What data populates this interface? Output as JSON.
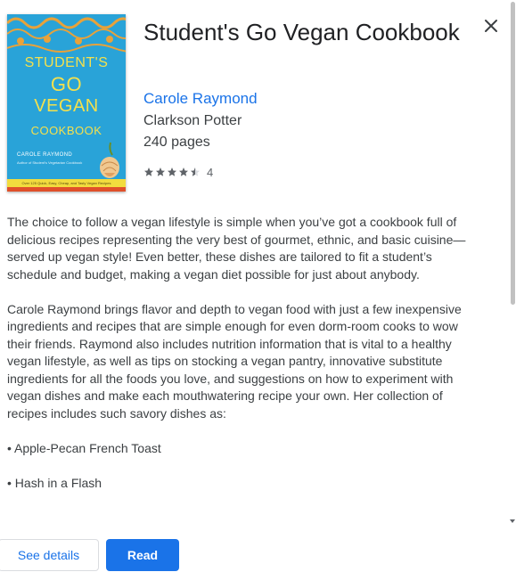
{
  "book": {
    "title": "Student's Go Vegan Cookbook",
    "author": "Carole Raymond",
    "publisher": "Clarkson Potter",
    "pages": "240 pages",
    "rating_value": "4",
    "rating_stars": 4.5
  },
  "cover": {
    "line1": "STUDENT'S",
    "line2": "GO",
    "line3": "VEGAN",
    "line4": "COOKBOOK",
    "author": "CAROLE RAYMOND",
    "subtitle": "Author of Student's Vegetarian Cookbook",
    "band": "Over 125 Quick, Easy, Cheap, and Tasty Vegan Recipes",
    "colors": {
      "background": "#29a3d8",
      "title": "#f4e04d",
      "band": "#f2dc3e"
    }
  },
  "description": {
    "paragraphs": [
      "The choice to follow a vegan lifestyle is simple when you’ve got a cookbook full of delicious recipes representing the very best of gourmet, ethnic, and basic cuisine—served up vegan style! Even better, these dishes are tailored to fit a student’s schedule and budget, making a vegan diet possible for just about anybody.",
      "Carole Raymond brings flavor and depth to vegan food with just a few inexpensive ingredients and recipes that are simple enough for even dorm-room cooks to wow their friends. Raymond also includes nutrition information that is vital to a healthy vegan lifestyle, as well as tips on stocking a vegan pantry, innovative substitute ingredients for all the foods you love, and suggestions on how to experiment with vegan dishes and make each mouthwatering recipe your own. Her collection of recipes includes such savory dishes as:",
      "• Apple-Pecan French Toast",
      "• Hash in a Flash"
    ]
  },
  "actions": {
    "see_details": "See details",
    "read": "Read"
  },
  "icons": {
    "close": "close-icon",
    "star": "star-icon"
  },
  "colors": {
    "accent": "#1a73e8",
    "text": "#202124",
    "muted": "#5f6368"
  }
}
